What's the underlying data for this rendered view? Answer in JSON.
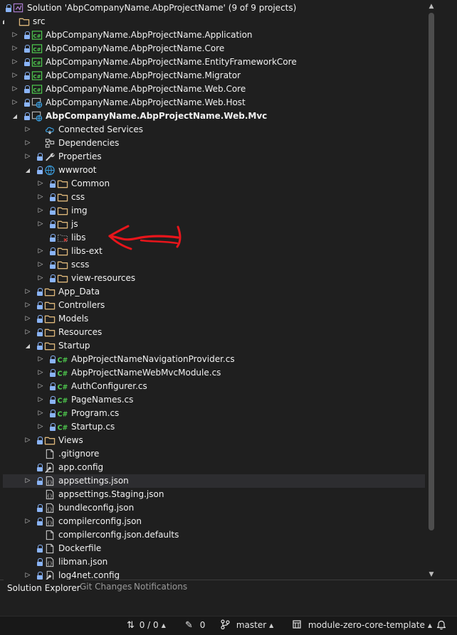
{
  "tree": [
    {
      "label": "Solution 'AbpCompanyName.AbpProjectName' (9 of 9 projects)",
      "icon": "solution-icon",
      "level": 0,
      "expander": "none",
      "lock": true,
      "name": "tree-item-solution"
    },
    {
      "label": "src",
      "icon": "folder-icon",
      "level": 1,
      "expander": "expanded",
      "lock": false,
      "name": "tree-item-src"
    },
    {
      "label": "AbpCompanyName.AbpProjectName.Application",
      "icon": "csharp-project-icon",
      "level": 2,
      "expander": "collapsed",
      "lock": true,
      "name": "tree-item-application"
    },
    {
      "label": "AbpCompanyName.AbpProjectName.Core",
      "icon": "csharp-project-icon",
      "level": 2,
      "expander": "collapsed",
      "lock": true,
      "name": "tree-item-core"
    },
    {
      "label": "AbpCompanyName.AbpProjectName.EntityFrameworkCore",
      "icon": "csharp-project-icon",
      "level": 2,
      "expander": "collapsed",
      "lock": true,
      "name": "tree-item-entityframeworkcore"
    },
    {
      "label": "AbpCompanyName.AbpProjectName.Migrator",
      "icon": "csharp-project-icon",
      "level": 2,
      "expander": "collapsed",
      "lock": true,
      "name": "tree-item-migrator"
    },
    {
      "label": "AbpCompanyName.AbpProjectName.Web.Core",
      "icon": "csharp-project-icon",
      "level": 2,
      "expander": "collapsed",
      "lock": true,
      "name": "tree-item-web-core"
    },
    {
      "label": "AbpCompanyName.AbpProjectName.Web.Host",
      "icon": "web-project-icon",
      "level": 2,
      "expander": "collapsed",
      "lock": true,
      "name": "tree-item-web-host"
    },
    {
      "label": "AbpCompanyName.AbpProjectName.Web.Mvc",
      "icon": "web-project-icon",
      "level": 2,
      "expander": "expanded",
      "lock": true,
      "bold": true,
      "name": "tree-item-web-mvc"
    },
    {
      "label": "Connected Services",
      "icon": "connected-services-icon",
      "level": 3,
      "expander": "collapsed",
      "lock": false,
      "name": "tree-item-connected-services"
    },
    {
      "label": "Dependencies",
      "icon": "dependencies-icon",
      "level": 3,
      "expander": "collapsed",
      "lock": false,
      "name": "tree-item-dependencies"
    },
    {
      "label": "Properties",
      "icon": "properties-icon",
      "level": 3,
      "expander": "collapsed",
      "lock": true,
      "name": "tree-item-properties"
    },
    {
      "label": "wwwroot",
      "icon": "globe-icon",
      "level": 3,
      "expander": "expanded",
      "lock": true,
      "name": "tree-item-wwwroot"
    },
    {
      "label": "Common",
      "icon": "folder-icon",
      "level": 4,
      "expander": "collapsed",
      "lock": true,
      "name": "tree-item-common"
    },
    {
      "label": "css",
      "icon": "folder-icon",
      "level": 4,
      "expander": "collapsed",
      "lock": true,
      "name": "tree-item-css"
    },
    {
      "label": "img",
      "icon": "folder-icon",
      "level": 4,
      "expander": "collapsed",
      "lock": true,
      "name": "tree-item-img"
    },
    {
      "label": "js",
      "icon": "folder-icon",
      "level": 4,
      "expander": "collapsed",
      "lock": true,
      "name": "tree-item-js"
    },
    {
      "label": "libs",
      "icon": "missing-folder-icon",
      "level": 4,
      "expander": "none",
      "lock": true,
      "name": "tree-item-libs"
    },
    {
      "label": "libs-ext",
      "icon": "folder-icon",
      "level": 4,
      "expander": "collapsed",
      "lock": true,
      "name": "tree-item-libs-ext"
    },
    {
      "label": "scss",
      "icon": "folder-icon",
      "level": 4,
      "expander": "collapsed",
      "lock": true,
      "name": "tree-item-scss"
    },
    {
      "label": "view-resources",
      "icon": "folder-icon",
      "level": 4,
      "expander": "collapsed",
      "lock": true,
      "name": "tree-item-view-resources"
    },
    {
      "label": "App_Data",
      "icon": "folder-icon",
      "level": 3,
      "expander": "collapsed",
      "lock": true,
      "name": "tree-item-app-data"
    },
    {
      "label": "Controllers",
      "icon": "folder-icon",
      "level": 3,
      "expander": "collapsed",
      "lock": true,
      "name": "tree-item-controllers"
    },
    {
      "label": "Models",
      "icon": "folder-icon",
      "level": 3,
      "expander": "collapsed",
      "lock": true,
      "name": "tree-item-models"
    },
    {
      "label": "Resources",
      "icon": "folder-icon",
      "level": 3,
      "expander": "collapsed",
      "lock": true,
      "name": "tree-item-resources"
    },
    {
      "label": "Startup",
      "icon": "folder-icon",
      "level": 3,
      "expander": "expanded",
      "lock": true,
      "name": "tree-item-startup"
    },
    {
      "label": "AbpProjectNameNavigationProvider.cs",
      "icon": "csharp-file-icon",
      "level": 4,
      "expander": "collapsed",
      "lock": true,
      "name": "tree-item-navigation-provider"
    },
    {
      "label": "AbpProjectNameWebMvcModule.cs",
      "icon": "csharp-file-icon",
      "level": 4,
      "expander": "collapsed",
      "lock": true,
      "name": "tree-item-webmvc-module"
    },
    {
      "label": "AuthConfigurer.cs",
      "icon": "csharp-file-icon",
      "level": 4,
      "expander": "collapsed",
      "lock": true,
      "name": "tree-item-auth-configurer"
    },
    {
      "label": "PageNames.cs",
      "icon": "csharp-file-icon",
      "level": 4,
      "expander": "collapsed",
      "lock": true,
      "name": "tree-item-page-names"
    },
    {
      "label": "Program.cs",
      "icon": "csharp-file-icon",
      "level": 4,
      "expander": "collapsed",
      "lock": true,
      "name": "tree-item-program"
    },
    {
      "label": "Startup.cs",
      "icon": "csharp-file-icon",
      "level": 4,
      "expander": "collapsed",
      "lock": true,
      "name": "tree-item-startup-cs"
    },
    {
      "label": "Views",
      "icon": "folder-icon",
      "level": 3,
      "expander": "collapsed",
      "lock": true,
      "name": "tree-item-views"
    },
    {
      "label": ".gitignore",
      "icon": "file-icon",
      "level": 3,
      "expander": "none",
      "lock": false,
      "name": "tree-item-gitignore"
    },
    {
      "label": "app.config",
      "icon": "config-file-icon",
      "level": 3,
      "expander": "none",
      "lock": true,
      "name": "tree-item-app-config"
    },
    {
      "label": "appsettings.json",
      "icon": "json-file-icon",
      "level": 3,
      "expander": "collapsed",
      "lock": true,
      "selected": true,
      "name": "tree-item-appsettings"
    },
    {
      "label": "appsettings.Staging.json",
      "icon": "json-file-icon",
      "level": 3,
      "expander": "none",
      "lock": false,
      "name": "tree-item-appsettings-staging"
    },
    {
      "label": "bundleconfig.json",
      "icon": "json-file-icon",
      "level": 3,
      "expander": "none",
      "lock": true,
      "name": "tree-item-bundleconfig"
    },
    {
      "label": "compilerconfig.json",
      "icon": "json-file-icon",
      "level": 3,
      "expander": "collapsed",
      "lock": true,
      "name": "tree-item-compilerconfig"
    },
    {
      "label": "compilerconfig.json.defaults",
      "icon": "file-icon",
      "level": 3,
      "expander": "none",
      "lock": false,
      "name": "tree-item-compilerconfig-defaults"
    },
    {
      "label": "Dockerfile",
      "icon": "file-icon",
      "level": 3,
      "expander": "none",
      "lock": true,
      "name": "tree-item-dockerfile"
    },
    {
      "label": "libman.json",
      "icon": "json-file-icon",
      "level": 3,
      "expander": "none",
      "lock": true,
      "name": "tree-item-libman"
    },
    {
      "label": "log4net.config",
      "icon": "config-file-icon",
      "level": 3,
      "expander": "collapsed",
      "lock": true,
      "name": "tree-item-log4net"
    }
  ],
  "tabs": [
    {
      "label": "Solution Explorer",
      "active": true
    },
    {
      "label": "Git Changes",
      "active": false
    },
    {
      "label": "Notifications",
      "active": false
    }
  ],
  "status": {
    "changes": "0 / 0",
    "pencil_count": "0",
    "branch": "master",
    "repository": "module-zero-core-template"
  },
  "colors": {
    "background": "#1f1f1f",
    "folder": "#dcb67a",
    "csharp": "#4ec94e",
    "lock": "#8ab4f8",
    "annotation": "#e8151b"
  }
}
